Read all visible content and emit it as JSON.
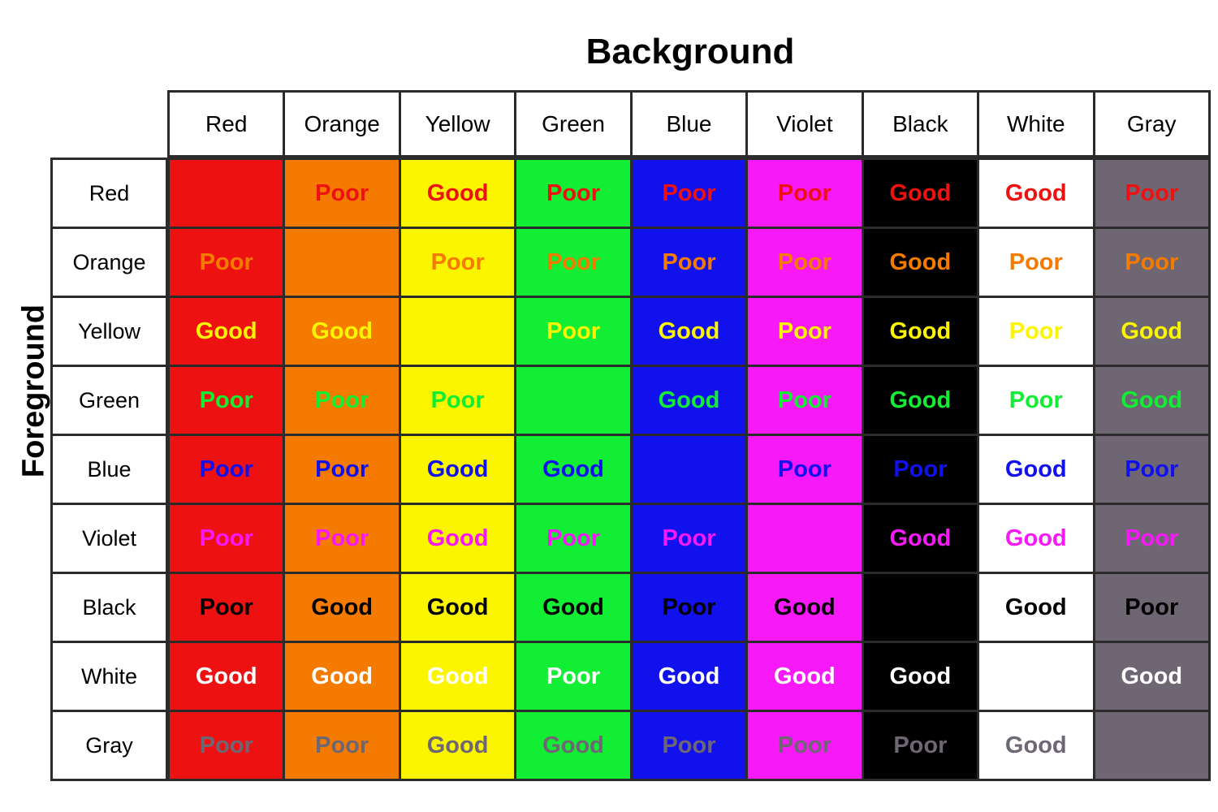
{
  "title": "Background",
  "axis_label_y": "Foreground",
  "legend_values": [
    "Good",
    "Poor"
  ],
  "chart_data": {
    "type": "heatmap",
    "title": "Background",
    "xlabel": "Background",
    "ylabel": "Foreground",
    "grid": true,
    "legend": "none",
    "categories": [
      "Red",
      "Orange",
      "Yellow",
      "Green",
      "Blue",
      "Violet",
      "Black",
      "White",
      "Gray"
    ],
    "rows": [
      "Red",
      "Orange",
      "Yellow",
      "Green",
      "Blue",
      "Violet",
      "Black",
      "White",
      "Gray"
    ],
    "columns": [
      "Red",
      "Orange",
      "Yellow",
      "Green",
      "Blue",
      "Violet",
      "Black",
      "White",
      "Gray"
    ],
    "swatches": {
      "Red": "#ee1111",
      "Orange": "#f57b00",
      "Yellow": "#fcf500",
      "Green": "#11ee33",
      "Blue": "#1111ee",
      "Violet": "#f719f7",
      "Black": "#000000",
      "White": "#ffffff",
      "Gray": "#6e6673"
    },
    "cells": [
      [
        {
          "background": "Red",
          "foreground": "Red",
          "value": ""
        },
        {
          "background": "Orange",
          "foreground": "Red",
          "value": "Poor"
        },
        {
          "background": "Yellow",
          "foreground": "Red",
          "value": "Good"
        },
        {
          "background": "Green",
          "foreground": "Red",
          "value": "Poor"
        },
        {
          "background": "Blue",
          "foreground": "Red",
          "value": "Poor"
        },
        {
          "background": "Violet",
          "foreground": "Red",
          "value": "Poor"
        },
        {
          "background": "Black",
          "foreground": "Red",
          "value": "Good"
        },
        {
          "background": "White",
          "foreground": "Red",
          "value": "Good"
        },
        {
          "background": "Gray",
          "foreground": "Red",
          "value": "Poor"
        }
      ],
      [
        {
          "background": "Red",
          "foreground": "Orange",
          "value": "Poor"
        },
        {
          "background": "Orange",
          "foreground": "Orange",
          "value": ""
        },
        {
          "background": "Yellow",
          "foreground": "Orange",
          "value": "Poor"
        },
        {
          "background": "Green",
          "foreground": "Orange",
          "value": "Poor"
        },
        {
          "background": "Blue",
          "foreground": "Orange",
          "value": "Poor"
        },
        {
          "background": "Violet",
          "foreground": "Orange",
          "value": "Poor"
        },
        {
          "background": "Black",
          "foreground": "Orange",
          "value": "Good"
        },
        {
          "background": "White",
          "foreground": "Orange",
          "value": "Poor"
        },
        {
          "background": "Gray",
          "foreground": "Orange",
          "value": "Poor"
        }
      ],
      [
        {
          "background": "Red",
          "foreground": "Yellow",
          "value": "Good"
        },
        {
          "background": "Orange",
          "foreground": "Yellow",
          "value": "Good"
        },
        {
          "background": "Yellow",
          "foreground": "Yellow",
          "value": ""
        },
        {
          "background": "Green",
          "foreground": "Yellow",
          "value": "Poor"
        },
        {
          "background": "Blue",
          "foreground": "Yellow",
          "value": "Good"
        },
        {
          "background": "Violet",
          "foreground": "Yellow",
          "value": "Poor"
        },
        {
          "background": "Black",
          "foreground": "Yellow",
          "value": "Good"
        },
        {
          "background": "White",
          "foreground": "Yellow",
          "value": "Poor"
        },
        {
          "background": "Gray",
          "foreground": "Yellow",
          "value": "Good"
        }
      ],
      [
        {
          "background": "Red",
          "foreground": "Green",
          "value": "Poor"
        },
        {
          "background": "Orange",
          "foreground": "Green",
          "value": "Poor"
        },
        {
          "background": "Yellow",
          "foreground": "Green",
          "value": "Poor"
        },
        {
          "background": "Green",
          "foreground": "Green",
          "value": ""
        },
        {
          "background": "Blue",
          "foreground": "Green",
          "value": "Good"
        },
        {
          "background": "Violet",
          "foreground": "Green",
          "value": "Poor"
        },
        {
          "background": "Black",
          "foreground": "Green",
          "value": "Good"
        },
        {
          "background": "White",
          "foreground": "Green",
          "value": "Poor"
        },
        {
          "background": "Gray",
          "foreground": "Green",
          "value": "Good"
        }
      ],
      [
        {
          "background": "Red",
          "foreground": "Blue",
          "value": "Poor"
        },
        {
          "background": "Orange",
          "foreground": "Blue",
          "value": "Poor"
        },
        {
          "background": "Yellow",
          "foreground": "Blue",
          "value": "Good"
        },
        {
          "background": "Green",
          "foreground": "Blue",
          "value": "Good"
        },
        {
          "background": "Blue",
          "foreground": "Blue",
          "value": ""
        },
        {
          "background": "Violet",
          "foreground": "Blue",
          "value": "Poor"
        },
        {
          "background": "Black",
          "foreground": "Blue",
          "value": "Poor"
        },
        {
          "background": "White",
          "foreground": "Blue",
          "value": "Good"
        },
        {
          "background": "Gray",
          "foreground": "Blue",
          "value": "Poor"
        }
      ],
      [
        {
          "background": "Red",
          "foreground": "Violet",
          "value": "Poor"
        },
        {
          "background": "Orange",
          "foreground": "Violet",
          "value": "Poor"
        },
        {
          "background": "Yellow",
          "foreground": "Violet",
          "value": "Good"
        },
        {
          "background": "Green",
          "foreground": "Violet",
          "value": "Poor"
        },
        {
          "background": "Blue",
          "foreground": "Violet",
          "value": "Poor"
        },
        {
          "background": "Violet",
          "foreground": "Violet",
          "value": ""
        },
        {
          "background": "Black",
          "foreground": "Violet",
          "value": "Good"
        },
        {
          "background": "White",
          "foreground": "Violet",
          "value": "Good"
        },
        {
          "background": "Gray",
          "foreground": "Violet",
          "value": "Poor"
        }
      ],
      [
        {
          "background": "Red",
          "foreground": "Black",
          "value": "Poor"
        },
        {
          "background": "Orange",
          "foreground": "Black",
          "value": "Good"
        },
        {
          "background": "Yellow",
          "foreground": "Black",
          "value": "Good"
        },
        {
          "background": "Green",
          "foreground": "Black",
          "value": "Good"
        },
        {
          "background": "Blue",
          "foreground": "Black",
          "value": "Poor"
        },
        {
          "background": "Violet",
          "foreground": "Black",
          "value": "Good"
        },
        {
          "background": "Black",
          "foreground": "Black",
          "value": ""
        },
        {
          "background": "White",
          "foreground": "Black",
          "value": "Good"
        },
        {
          "background": "Gray",
          "foreground": "Black",
          "value": "Poor"
        }
      ],
      [
        {
          "background": "Red",
          "foreground": "White",
          "value": "Good"
        },
        {
          "background": "Orange",
          "foreground": "White",
          "value": "Good"
        },
        {
          "background": "Yellow",
          "foreground": "White",
          "value": "Good"
        },
        {
          "background": "Green",
          "foreground": "White",
          "value": "Poor"
        },
        {
          "background": "Blue",
          "foreground": "White",
          "value": "Good"
        },
        {
          "background": "Violet",
          "foreground": "White",
          "value": "Good"
        },
        {
          "background": "Black",
          "foreground": "White",
          "value": "Good"
        },
        {
          "background": "White",
          "foreground": "White",
          "value": ""
        },
        {
          "background": "Gray",
          "foreground": "White",
          "value": "Good"
        }
      ],
      [
        {
          "background": "Red",
          "foreground": "Gray",
          "value": "Poor"
        },
        {
          "background": "Orange",
          "foreground": "Gray",
          "value": "Poor"
        },
        {
          "background": "Yellow",
          "foreground": "Gray",
          "value": "Good"
        },
        {
          "background": "Green",
          "foreground": "Gray",
          "value": "Good"
        },
        {
          "background": "Blue",
          "foreground": "Gray",
          "value": "Poor"
        },
        {
          "background": "Violet",
          "foreground": "Gray",
          "value": "Poor"
        },
        {
          "background": "Black",
          "foreground": "Gray",
          "value": "Poor"
        },
        {
          "background": "White",
          "foreground": "Gray",
          "value": "Good"
        },
        {
          "background": "Gray",
          "foreground": "Gray",
          "value": ""
        }
      ]
    ]
  }
}
